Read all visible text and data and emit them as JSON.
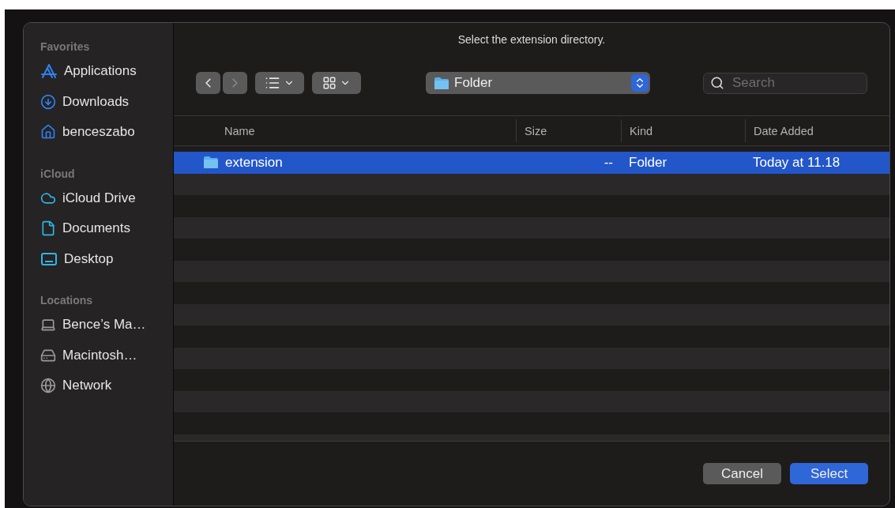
{
  "dialog": {
    "title": "Select the extension directory."
  },
  "sidebar": {
    "sections": [
      {
        "heading": "Favorites",
        "items": [
          {
            "label": "Applications",
            "kind": "apps"
          },
          {
            "label": "Downloads",
            "kind": "download"
          },
          {
            "label": "benceszabo",
            "kind": "home"
          }
        ]
      },
      {
        "heading": "iCloud",
        "items": [
          {
            "label": "iCloud Drive",
            "kind": "cloud"
          },
          {
            "label": "Documents",
            "kind": "document"
          },
          {
            "label": "Desktop",
            "kind": "desktop"
          }
        ]
      },
      {
        "heading": "Locations",
        "items": [
          {
            "label": "Bence’s Ma…",
            "kind": "laptop"
          },
          {
            "label": "Macintosh…",
            "kind": "disk"
          },
          {
            "label": "Network",
            "kind": "globe"
          }
        ]
      }
    ]
  },
  "toolbar": {
    "back": {
      "disabled": false
    },
    "forward": {
      "disabled": true
    },
    "location": "Folder",
    "search": {
      "placeholder": "Search"
    }
  },
  "table": {
    "columns": [
      "Name",
      "Size",
      "Kind",
      "Date Added"
    ],
    "rows": [
      {
        "name": "extension",
        "size": "--",
        "kind": "Folder",
        "date": "Today at 11.18",
        "selected": true
      }
    ]
  },
  "buttons": [
    {
      "label": "Cancel",
      "primary": false
    },
    {
      "label": "Select",
      "primary": true
    }
  ]
}
